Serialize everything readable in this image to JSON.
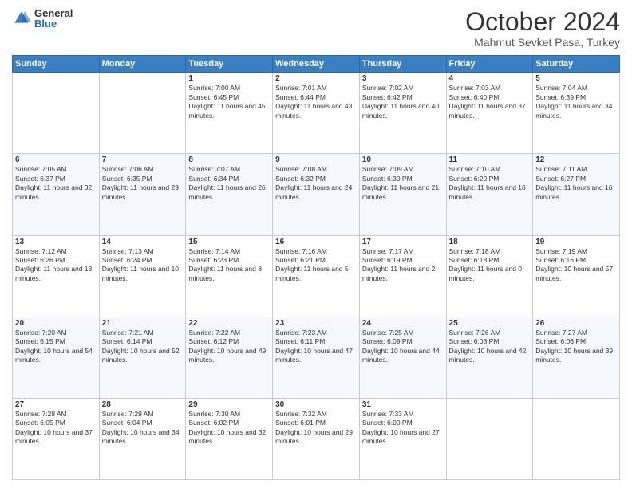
{
  "logo": {
    "general": "General",
    "blue": "Blue"
  },
  "header": {
    "month": "October 2024",
    "location": "Mahmut Sevket Pasa, Turkey"
  },
  "weekdays": [
    "Sunday",
    "Monday",
    "Tuesday",
    "Wednesday",
    "Thursday",
    "Friday",
    "Saturday"
  ],
  "weeks": [
    [
      {
        "day": "",
        "sunrise": "",
        "sunset": "",
        "daylight": ""
      },
      {
        "day": "",
        "sunrise": "",
        "sunset": "",
        "daylight": ""
      },
      {
        "day": "1",
        "sunrise": "Sunrise: 7:00 AM",
        "sunset": "Sunset: 6:45 PM",
        "daylight": "Daylight: 11 hours and 45 minutes."
      },
      {
        "day": "2",
        "sunrise": "Sunrise: 7:01 AM",
        "sunset": "Sunset: 6:44 PM",
        "daylight": "Daylight: 11 hours and 43 minutes."
      },
      {
        "day": "3",
        "sunrise": "Sunrise: 7:02 AM",
        "sunset": "Sunset: 6:42 PM",
        "daylight": "Daylight: 11 hours and 40 minutes."
      },
      {
        "day": "4",
        "sunrise": "Sunrise: 7:03 AM",
        "sunset": "Sunset: 6:40 PM",
        "daylight": "Daylight: 11 hours and 37 minutes."
      },
      {
        "day": "5",
        "sunrise": "Sunrise: 7:04 AM",
        "sunset": "Sunset: 6:39 PM",
        "daylight": "Daylight: 11 hours and 34 minutes."
      }
    ],
    [
      {
        "day": "6",
        "sunrise": "Sunrise: 7:05 AM",
        "sunset": "Sunset: 6:37 PM",
        "daylight": "Daylight: 11 hours and 32 minutes."
      },
      {
        "day": "7",
        "sunrise": "Sunrise: 7:06 AM",
        "sunset": "Sunset: 6:35 PM",
        "daylight": "Daylight: 11 hours and 29 minutes."
      },
      {
        "day": "8",
        "sunrise": "Sunrise: 7:07 AM",
        "sunset": "Sunset: 6:34 PM",
        "daylight": "Daylight: 11 hours and 26 minutes."
      },
      {
        "day": "9",
        "sunrise": "Sunrise: 7:08 AM",
        "sunset": "Sunset: 6:32 PM",
        "daylight": "Daylight: 11 hours and 24 minutes."
      },
      {
        "day": "10",
        "sunrise": "Sunrise: 7:09 AM",
        "sunset": "Sunset: 6:30 PM",
        "daylight": "Daylight: 11 hours and 21 minutes."
      },
      {
        "day": "11",
        "sunrise": "Sunrise: 7:10 AM",
        "sunset": "Sunset: 6:29 PM",
        "daylight": "Daylight: 11 hours and 18 minutes."
      },
      {
        "day": "12",
        "sunrise": "Sunrise: 7:11 AM",
        "sunset": "Sunset: 6:27 PM",
        "daylight": "Daylight: 11 hours and 16 minutes."
      }
    ],
    [
      {
        "day": "13",
        "sunrise": "Sunrise: 7:12 AM",
        "sunset": "Sunset: 6:26 PM",
        "daylight": "Daylight: 11 hours and 13 minutes."
      },
      {
        "day": "14",
        "sunrise": "Sunrise: 7:13 AM",
        "sunset": "Sunset: 6:24 PM",
        "daylight": "Daylight: 11 hours and 10 minutes."
      },
      {
        "day": "15",
        "sunrise": "Sunrise: 7:14 AM",
        "sunset": "Sunset: 6:23 PM",
        "daylight": "Daylight: 11 hours and 8 minutes."
      },
      {
        "day": "16",
        "sunrise": "Sunrise: 7:16 AM",
        "sunset": "Sunset: 6:21 PM",
        "daylight": "Daylight: 11 hours and 5 minutes."
      },
      {
        "day": "17",
        "sunrise": "Sunrise: 7:17 AM",
        "sunset": "Sunset: 6:19 PM",
        "daylight": "Daylight: 11 hours and 2 minutes."
      },
      {
        "day": "18",
        "sunrise": "Sunrise: 7:18 AM",
        "sunset": "Sunset: 6:18 PM",
        "daylight": "Daylight: 11 hours and 0 minutes."
      },
      {
        "day": "19",
        "sunrise": "Sunrise: 7:19 AM",
        "sunset": "Sunset: 6:16 PM",
        "daylight": "Daylight: 10 hours and 57 minutes."
      }
    ],
    [
      {
        "day": "20",
        "sunrise": "Sunrise: 7:20 AM",
        "sunset": "Sunset: 6:15 PM",
        "daylight": "Daylight: 10 hours and 54 minutes."
      },
      {
        "day": "21",
        "sunrise": "Sunrise: 7:21 AM",
        "sunset": "Sunset: 6:14 PM",
        "daylight": "Daylight: 10 hours and 52 minutes."
      },
      {
        "day": "22",
        "sunrise": "Sunrise: 7:22 AM",
        "sunset": "Sunset: 6:12 PM",
        "daylight": "Daylight: 10 hours and 49 minutes."
      },
      {
        "day": "23",
        "sunrise": "Sunrise: 7:23 AM",
        "sunset": "Sunset: 6:11 PM",
        "daylight": "Daylight: 10 hours and 47 minutes."
      },
      {
        "day": "24",
        "sunrise": "Sunrise: 7:25 AM",
        "sunset": "Sunset: 6:09 PM",
        "daylight": "Daylight: 10 hours and 44 minutes."
      },
      {
        "day": "25",
        "sunrise": "Sunrise: 7:26 AM",
        "sunset": "Sunset: 6:08 PM",
        "daylight": "Daylight: 10 hours and 42 minutes."
      },
      {
        "day": "26",
        "sunrise": "Sunrise: 7:27 AM",
        "sunset": "Sunset: 6:06 PM",
        "daylight": "Daylight: 10 hours and 39 minutes."
      }
    ],
    [
      {
        "day": "27",
        "sunrise": "Sunrise: 7:28 AM",
        "sunset": "Sunset: 6:05 PM",
        "daylight": "Daylight: 10 hours and 37 minutes."
      },
      {
        "day": "28",
        "sunrise": "Sunrise: 7:29 AM",
        "sunset": "Sunset: 6:04 PM",
        "daylight": "Daylight: 10 hours and 34 minutes."
      },
      {
        "day": "29",
        "sunrise": "Sunrise: 7:30 AM",
        "sunset": "Sunset: 6:02 PM",
        "daylight": "Daylight: 10 hours and 32 minutes."
      },
      {
        "day": "30",
        "sunrise": "Sunrise: 7:32 AM",
        "sunset": "Sunset: 6:01 PM",
        "daylight": "Daylight: 10 hours and 29 minutes."
      },
      {
        "day": "31",
        "sunrise": "Sunrise: 7:33 AM",
        "sunset": "Sunset: 6:00 PM",
        "daylight": "Daylight: 10 hours and 27 minutes."
      },
      {
        "day": "",
        "sunrise": "",
        "sunset": "",
        "daylight": ""
      },
      {
        "day": "",
        "sunrise": "",
        "sunset": "",
        "daylight": ""
      }
    ]
  ]
}
